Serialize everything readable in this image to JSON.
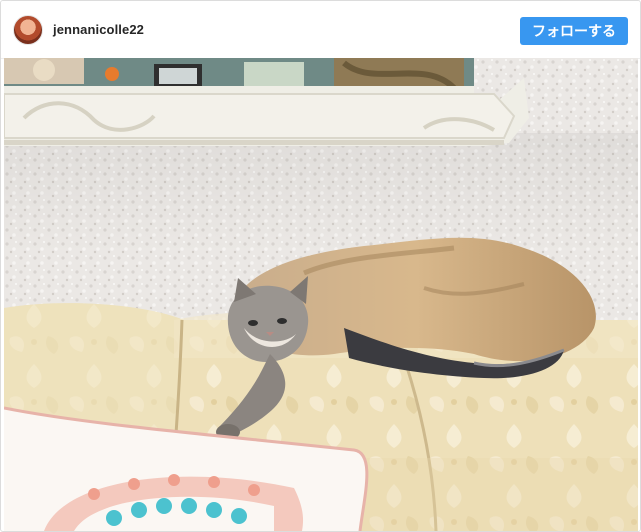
{
  "post": {
    "username": "jennanicolle22",
    "follow_label": "フォローする"
  },
  "colors": {
    "follow_button": "#3897f0",
    "wall": "#e9e6e3",
    "sofa": "#efe2bd",
    "frame": "#efefe6"
  }
}
